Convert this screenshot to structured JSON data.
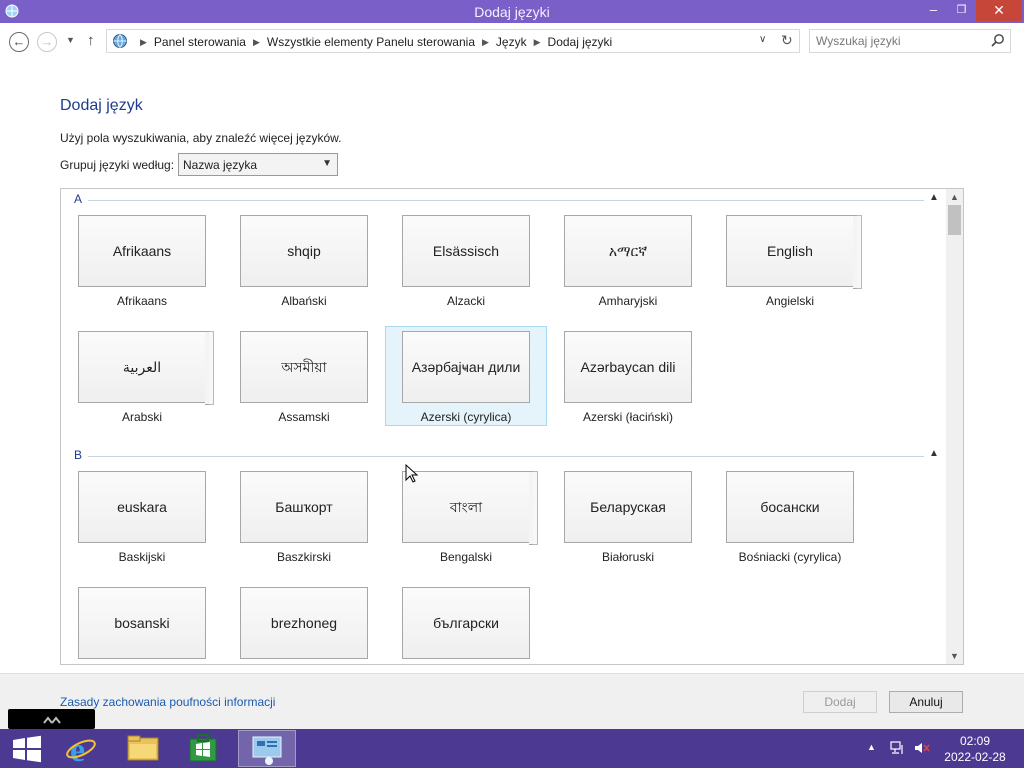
{
  "window": {
    "title": "Dodaj języki"
  },
  "nav": {
    "breadcrumbs": [
      "Panel sterowania",
      "Wszystkie elementy Panelu sterowania",
      "Język",
      "Dodaj języki"
    ],
    "search_placeholder": "Wyszukaj języki"
  },
  "content": {
    "title": "Dodaj język",
    "hint": "Użyj pola wyszukiwania, aby znaleźć więcej języków.",
    "group_by_label": "Grupuj języki według:",
    "group_by_value": "Nazwa języka"
  },
  "groups": [
    {
      "letter": "A",
      "languages": [
        {
          "native": "Afrikaans",
          "name": "Afrikaans"
        },
        {
          "native": "shqip",
          "name": "Albański"
        },
        {
          "native": "Elsässisch",
          "name": "Alzacki"
        },
        {
          "native": "አማርኛ",
          "name": "Amharyjski"
        },
        {
          "native": "English",
          "name": "Angielski"
        },
        {
          "native": "العربية",
          "name": "Arabski"
        },
        {
          "native": "অসমীয়া",
          "name": "Assamski"
        },
        {
          "native": "Азәрбајҹан дили",
          "name": "Azerski (cyrylica)"
        },
        {
          "native": "Azərbaycan dili",
          "name": "Azerski (łaciński)"
        }
      ]
    },
    {
      "letter": "B",
      "languages": [
        {
          "native": "euskara",
          "name": "Baskijski"
        },
        {
          "native": "Башҡорт",
          "name": "Baszkirski"
        },
        {
          "native": "বাংলা",
          "name": "Bengalski"
        },
        {
          "native": "Беларуская",
          "name": "Białoruski"
        },
        {
          "native": "босански",
          "name": "Bośniacki (cyrylica)"
        },
        {
          "native": "bosanski",
          "name": ""
        },
        {
          "native": "brezhoneg",
          "name": ""
        },
        {
          "native": "български",
          "name": ""
        }
      ]
    }
  ],
  "footer": {
    "privacy_link": "Zasady zachowania poufności informacji",
    "add_button": "Dodaj",
    "cancel_button": "Anuluj"
  },
  "taskbar": {
    "time": "02:09",
    "date": "2022-02-28"
  },
  "colors": {
    "titlebar": "#7b5fc8",
    "taskbar": "#4c3a92",
    "heading": "#1e3d8c",
    "selection": "#e5f3fb",
    "link": "#1a5bb3"
  }
}
